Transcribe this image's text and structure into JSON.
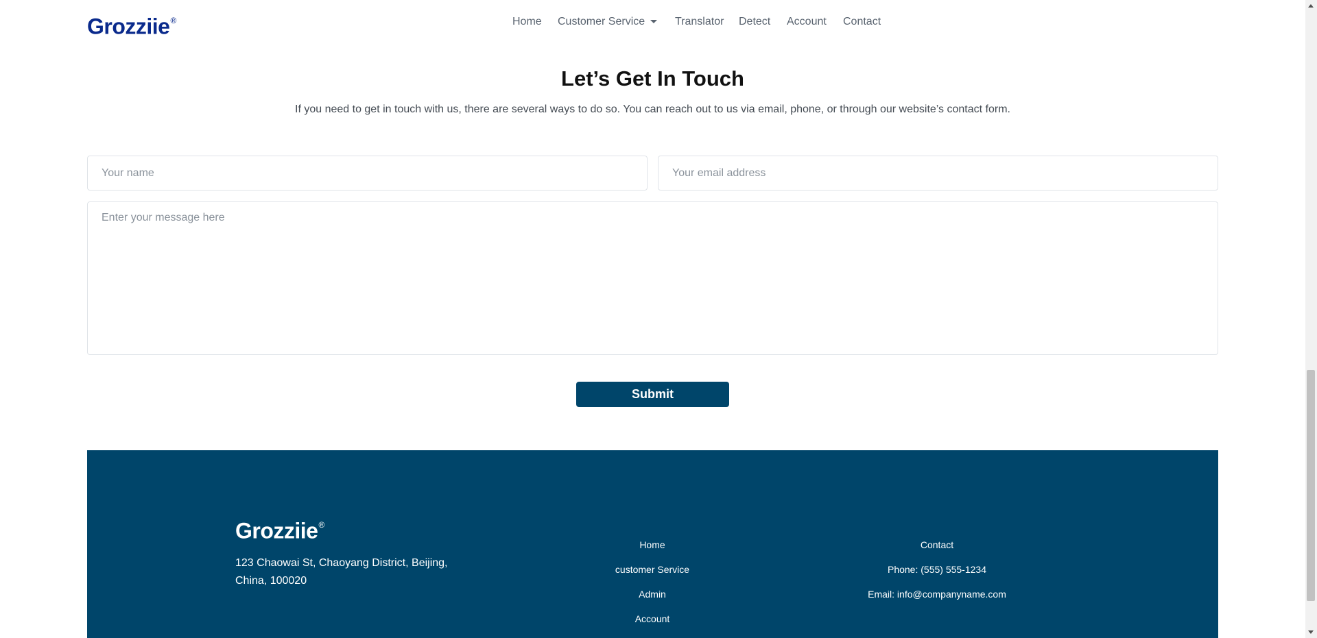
{
  "brand": {
    "name": "Grozziie",
    "mark": "®"
  },
  "nav": {
    "items": [
      {
        "label": "Home"
      },
      {
        "label": "Customer Service",
        "dropdown": true
      },
      {
        "label": "Translator"
      },
      {
        "label": "Detect"
      },
      {
        "label": "Account"
      },
      {
        "label": "Contact"
      }
    ]
  },
  "contact": {
    "title": "Let’s Get In Touch",
    "subtitle": "If you need to get in touch with us, there are several ways to do so. You can reach out to us via email, phone, or through our website’s contact form.",
    "name_placeholder": "Your name",
    "email_placeholder": "Your email address",
    "message_placeholder": "Enter your message here",
    "submit_label": "Submit"
  },
  "footer": {
    "brand": "Grozziie",
    "mark": "®",
    "address": "123 Chaowai St, Chaoyang District, Beijing, China, 100020",
    "links": [
      "Home",
      "customer Service",
      "Admin",
      "Account"
    ],
    "contact_heading": "Contact",
    "phone_label": "Phone:",
    "phone": "(555) 555-1234",
    "email_label": "Email:",
    "email": "info@companyname.com"
  },
  "colors": {
    "brand_blue": "#0a2a8c",
    "primary": "#00456a",
    "nav_text": "#5a6470"
  }
}
